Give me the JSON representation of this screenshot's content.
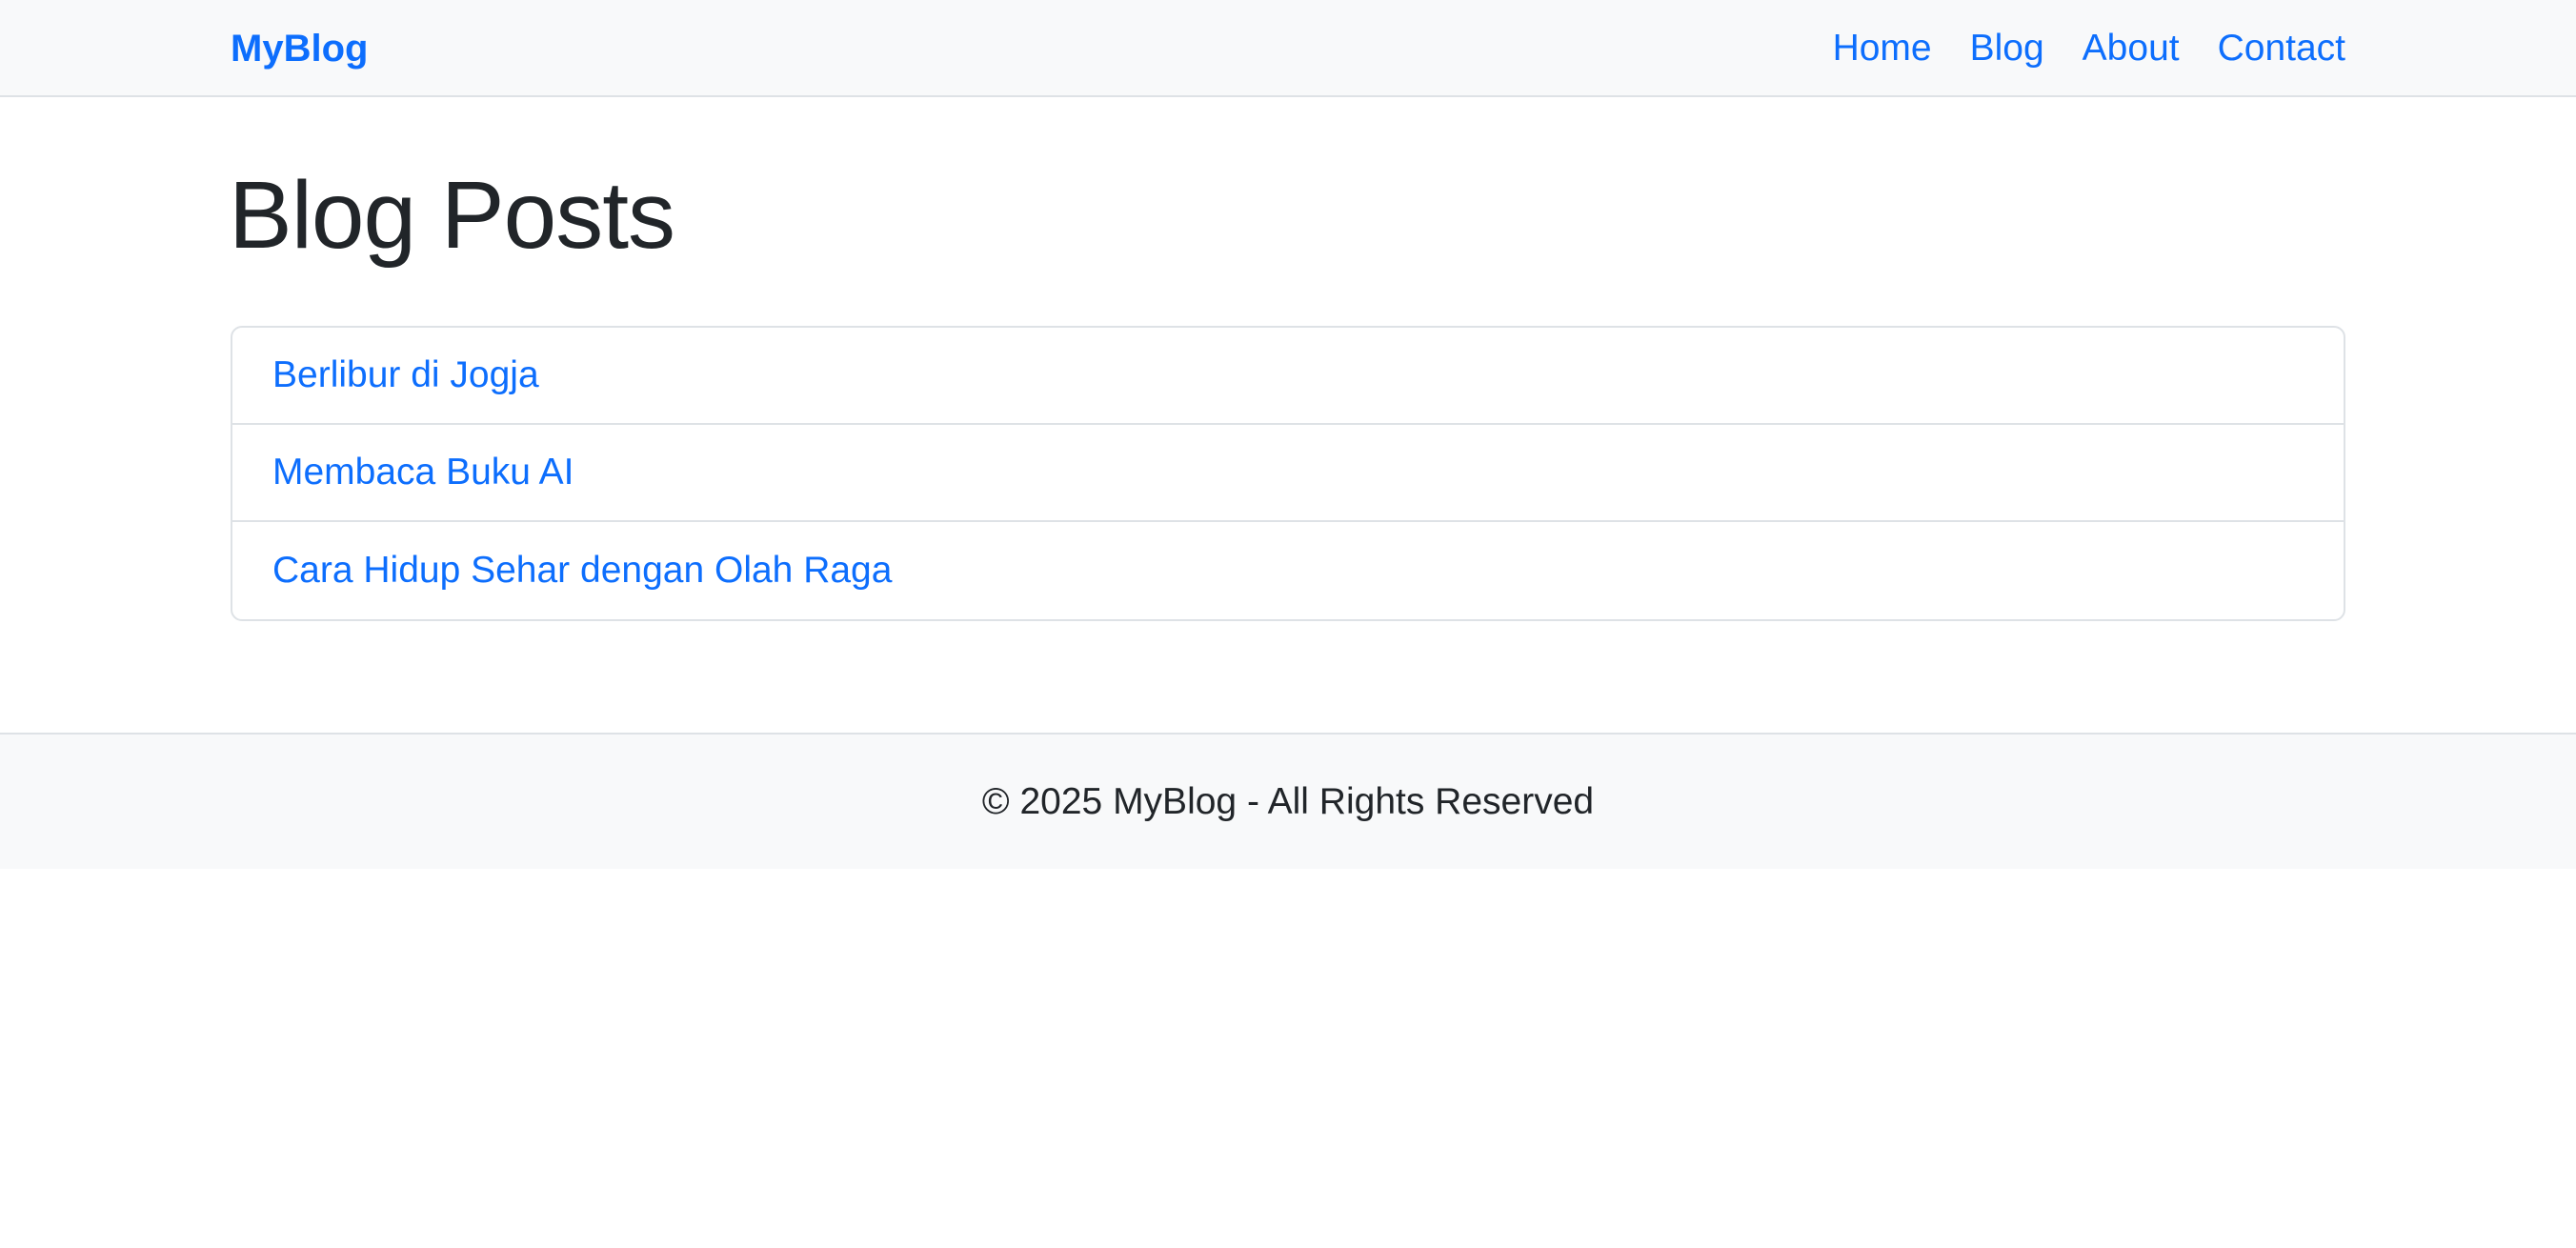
{
  "navbar": {
    "brand": "MyBlog",
    "links": [
      "Home",
      "Blog",
      "About",
      "Contact"
    ]
  },
  "main": {
    "title": "Blog Posts",
    "posts": [
      "Berlibur di Jogja",
      "Membaca Buku AI",
      "Cara Hidup Sehar dengan Olah Raga"
    ]
  },
  "footer": {
    "text": "© 2025 MyBlog - All Rights Reserved"
  },
  "colors": {
    "link": "#0d6efd",
    "navbar_bg": "#f8f9fa",
    "border": "#dee2e6",
    "text": "#212529"
  }
}
